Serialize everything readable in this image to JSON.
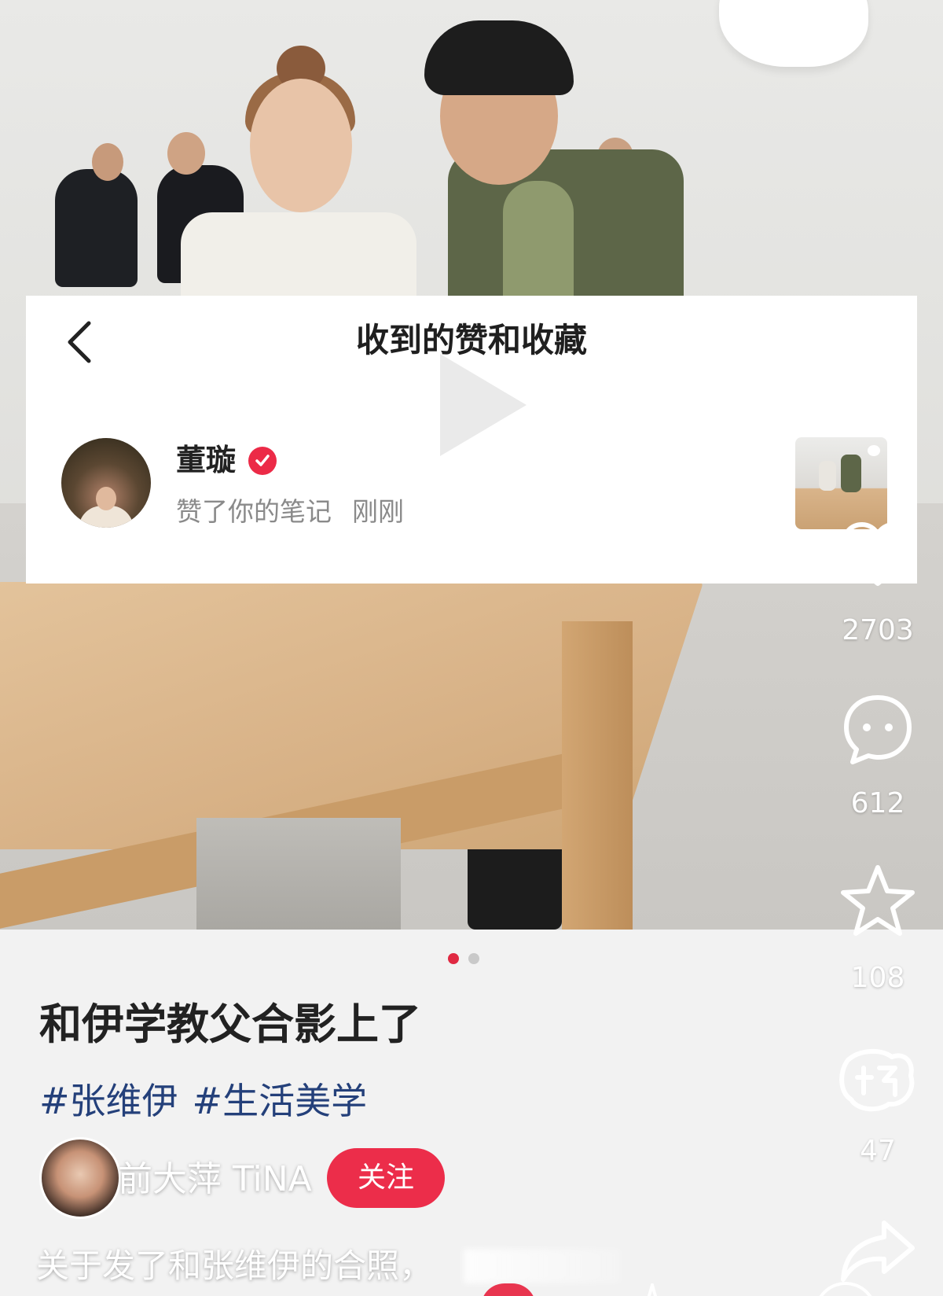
{
  "notification": {
    "title": "收到的赞和收藏",
    "user_name": "董璇",
    "verified_icon": "verified-check-icon",
    "action_text": "赞了你的笔记",
    "time": "刚刚"
  },
  "rail": {
    "like_count": "2703",
    "comment_count": "612",
    "collect_count": "108",
    "good_count": "47"
  },
  "post": {
    "title": "和伊学教父合影上了",
    "tags": [
      "#张维伊",
      "#生活美学"
    ],
    "author_name": "前大萍 TiNA",
    "follow_label": "关注",
    "caption": "关于发了和张维伊的合照，"
  },
  "carousel": {
    "total": 2,
    "active_index": 0
  },
  "colors": {
    "accent": "#ec2d4a",
    "tag": "#24407a",
    "verified": "#ec2a47"
  }
}
